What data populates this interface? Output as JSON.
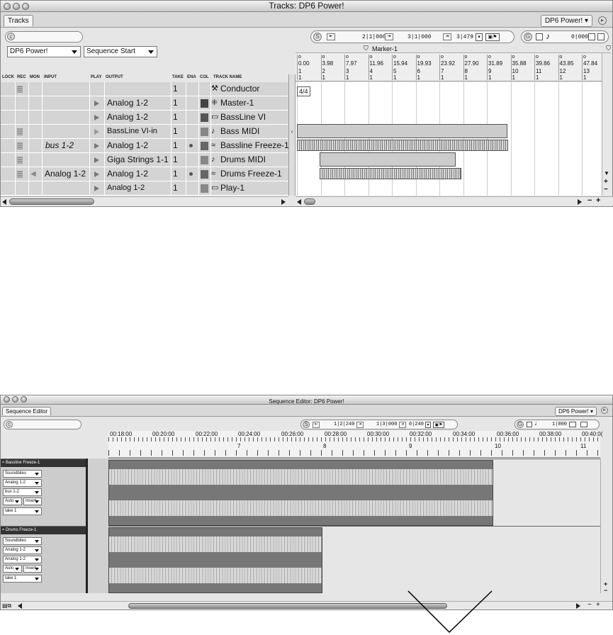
{
  "tracks_window": {
    "title": "Tracks: DP6 Power!",
    "tab": "Tracks",
    "project_menu": "DP6 Power!",
    "search_placeholder": "",
    "counter_start": "2|1|000",
    "counter_end": "3|1|000",
    "counter_len": "3|479",
    "counter_tempo": "0|000",
    "sequence_menu": "DP6 Power!",
    "start_menu": "Sequence Start",
    "marker": "Marker-1",
    "meter": "4/4",
    "columns": [
      "LOCK",
      "REC",
      "MON",
      "INPUT",
      "PLAY",
      "OUTPUT",
      "TAKE",
      "ENA",
      "COL",
      "TRACK NAME"
    ],
    "ruler_times": [
      "0.00",
      "3.98",
      "7.97",
      "11.96",
      "15.94",
      "19.93",
      "23.92",
      "27.90",
      "31.89",
      "35.88",
      "39.86",
      "43.85",
      "47.84"
    ],
    "ruler_bars": [
      "1",
      "2",
      "3",
      "4",
      "5",
      "6",
      "7",
      "8",
      "9",
      "10",
      "11",
      "12",
      "13"
    ],
    "ruler_beats": [
      "1",
      "1",
      "1",
      "1",
      "1",
      "1",
      "1",
      "1",
      "1",
      "1",
      "1",
      "1",
      "1"
    ],
    "rows": [
      {
        "input": "",
        "output": "",
        "take": "1",
        "name": "Conductor",
        "icon": "conductor-icon",
        "glyph": "⚒"
      },
      {
        "input": "",
        "output": "Analog 1-2",
        "take": "1",
        "name": "Master-1",
        "icon": "master-icon",
        "glyph": "⁜"
      },
      {
        "input": "",
        "output": "Analog 1-2",
        "take": "1",
        "name": "BassLine VI",
        "icon": "instrument-icon",
        "glyph": "▭"
      },
      {
        "input": "",
        "output": "BassLine VI-in",
        "take": "1",
        "name": "Bass MIDI",
        "icon": "midi-note-icon",
        "glyph": "♪"
      },
      {
        "input": "bus 1-2",
        "output": "Analog 1-2",
        "take": "1",
        "name": "Bassline Freeze-1",
        "icon": "audio-wave-icon",
        "glyph": "≈"
      },
      {
        "input": "",
        "output": "Giga Strings 1-1",
        "take": "1",
        "name": "Drums MIDI",
        "icon": "midi-note-icon",
        "glyph": "♪"
      },
      {
        "input": "Analog 1-2",
        "output": "Analog 1-2",
        "take": "1",
        "name": "Drums Freeze-1",
        "icon": "audio-wave-icon",
        "glyph": "≈"
      },
      {
        "input": "",
        "output": "Analog 1-2",
        "take": "1",
        "name": "Play-1",
        "icon": "instrument-icon",
        "glyph": "▭"
      }
    ]
  },
  "sequence_window": {
    "title": "Sequence Editor: DP6 Power!",
    "tab": "Sequence Editor",
    "project_menu": "DP6 Power!",
    "counter_start": "1|2|240",
    "counter_end": "1|3|000",
    "counter_len": "0|240",
    "counter_tempo": "1|000",
    "time_ticks": [
      "00:18:00",
      "00:20:00",
      "00:22:00",
      "00:24:00",
      "00:26:00",
      "00:28:00",
      "00:30:00",
      "00:32:00",
      "00:34:00",
      "00:36:00",
      "00:38:00",
      "00:40:0("
    ],
    "bar_ticks": [
      "7",
      "8",
      "9",
      "10",
      "11"
    ],
    "tracks": [
      {
        "name": "Bassline Freeze-1",
        "menus": [
          "Soundbites",
          "Analog 1-2",
          "bus 1-2",
          "Auto",
          "Insert",
          "take 1"
        ]
      },
      {
        "name": "Drums Freeze-1",
        "menus": [
          "Soundbites",
          "Analog 1-2",
          "Analog 1-2",
          "Auto",
          "Insert",
          "take 1"
        ]
      }
    ]
  }
}
